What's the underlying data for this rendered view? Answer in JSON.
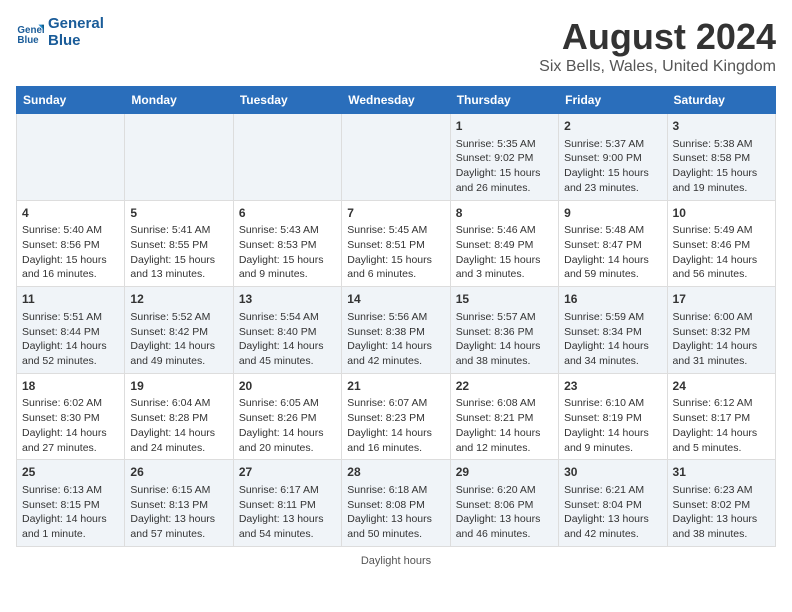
{
  "header": {
    "logo_line1": "General",
    "logo_line2": "Blue",
    "main_title": "August 2024",
    "sub_title": "Six Bells, Wales, United Kingdom"
  },
  "footer": {
    "note": "Daylight hours"
  },
  "weekdays": [
    "Sunday",
    "Monday",
    "Tuesday",
    "Wednesday",
    "Thursday",
    "Friday",
    "Saturday"
  ],
  "weeks": [
    [
      {
        "day": "",
        "info": ""
      },
      {
        "day": "",
        "info": ""
      },
      {
        "day": "",
        "info": ""
      },
      {
        "day": "",
        "info": ""
      },
      {
        "day": "1",
        "info": "Sunrise: 5:35 AM\nSunset: 9:02 PM\nDaylight: 15 hours\nand 26 minutes."
      },
      {
        "day": "2",
        "info": "Sunrise: 5:37 AM\nSunset: 9:00 PM\nDaylight: 15 hours\nand 23 minutes."
      },
      {
        "day": "3",
        "info": "Sunrise: 5:38 AM\nSunset: 8:58 PM\nDaylight: 15 hours\nand 19 minutes."
      }
    ],
    [
      {
        "day": "4",
        "info": "Sunrise: 5:40 AM\nSunset: 8:56 PM\nDaylight: 15 hours\nand 16 minutes."
      },
      {
        "day": "5",
        "info": "Sunrise: 5:41 AM\nSunset: 8:55 PM\nDaylight: 15 hours\nand 13 minutes."
      },
      {
        "day": "6",
        "info": "Sunrise: 5:43 AM\nSunset: 8:53 PM\nDaylight: 15 hours\nand 9 minutes."
      },
      {
        "day": "7",
        "info": "Sunrise: 5:45 AM\nSunset: 8:51 PM\nDaylight: 15 hours\nand 6 minutes."
      },
      {
        "day": "8",
        "info": "Sunrise: 5:46 AM\nSunset: 8:49 PM\nDaylight: 15 hours\nand 3 minutes."
      },
      {
        "day": "9",
        "info": "Sunrise: 5:48 AM\nSunset: 8:47 PM\nDaylight: 14 hours\nand 59 minutes."
      },
      {
        "day": "10",
        "info": "Sunrise: 5:49 AM\nSunset: 8:46 PM\nDaylight: 14 hours\nand 56 minutes."
      }
    ],
    [
      {
        "day": "11",
        "info": "Sunrise: 5:51 AM\nSunset: 8:44 PM\nDaylight: 14 hours\nand 52 minutes."
      },
      {
        "day": "12",
        "info": "Sunrise: 5:52 AM\nSunset: 8:42 PM\nDaylight: 14 hours\nand 49 minutes."
      },
      {
        "day": "13",
        "info": "Sunrise: 5:54 AM\nSunset: 8:40 PM\nDaylight: 14 hours\nand 45 minutes."
      },
      {
        "day": "14",
        "info": "Sunrise: 5:56 AM\nSunset: 8:38 PM\nDaylight: 14 hours\nand 42 minutes."
      },
      {
        "day": "15",
        "info": "Sunrise: 5:57 AM\nSunset: 8:36 PM\nDaylight: 14 hours\nand 38 minutes."
      },
      {
        "day": "16",
        "info": "Sunrise: 5:59 AM\nSunset: 8:34 PM\nDaylight: 14 hours\nand 34 minutes."
      },
      {
        "day": "17",
        "info": "Sunrise: 6:00 AM\nSunset: 8:32 PM\nDaylight: 14 hours\nand 31 minutes."
      }
    ],
    [
      {
        "day": "18",
        "info": "Sunrise: 6:02 AM\nSunset: 8:30 PM\nDaylight: 14 hours\nand 27 minutes."
      },
      {
        "day": "19",
        "info": "Sunrise: 6:04 AM\nSunset: 8:28 PM\nDaylight: 14 hours\nand 24 minutes."
      },
      {
        "day": "20",
        "info": "Sunrise: 6:05 AM\nSunset: 8:26 PM\nDaylight: 14 hours\nand 20 minutes."
      },
      {
        "day": "21",
        "info": "Sunrise: 6:07 AM\nSunset: 8:23 PM\nDaylight: 14 hours\nand 16 minutes."
      },
      {
        "day": "22",
        "info": "Sunrise: 6:08 AM\nSunset: 8:21 PM\nDaylight: 14 hours\nand 12 minutes."
      },
      {
        "day": "23",
        "info": "Sunrise: 6:10 AM\nSunset: 8:19 PM\nDaylight: 14 hours\nand 9 minutes."
      },
      {
        "day": "24",
        "info": "Sunrise: 6:12 AM\nSunset: 8:17 PM\nDaylight: 14 hours\nand 5 minutes."
      }
    ],
    [
      {
        "day": "25",
        "info": "Sunrise: 6:13 AM\nSunset: 8:15 PM\nDaylight: 14 hours\nand 1 minute."
      },
      {
        "day": "26",
        "info": "Sunrise: 6:15 AM\nSunset: 8:13 PM\nDaylight: 13 hours\nand 57 minutes."
      },
      {
        "day": "27",
        "info": "Sunrise: 6:17 AM\nSunset: 8:11 PM\nDaylight: 13 hours\nand 54 minutes."
      },
      {
        "day": "28",
        "info": "Sunrise: 6:18 AM\nSunset: 8:08 PM\nDaylight: 13 hours\nand 50 minutes."
      },
      {
        "day": "29",
        "info": "Sunrise: 6:20 AM\nSunset: 8:06 PM\nDaylight: 13 hours\nand 46 minutes."
      },
      {
        "day": "30",
        "info": "Sunrise: 6:21 AM\nSunset: 8:04 PM\nDaylight: 13 hours\nand 42 minutes."
      },
      {
        "day": "31",
        "info": "Sunrise: 6:23 AM\nSunset: 8:02 PM\nDaylight: 13 hours\nand 38 minutes."
      }
    ]
  ]
}
